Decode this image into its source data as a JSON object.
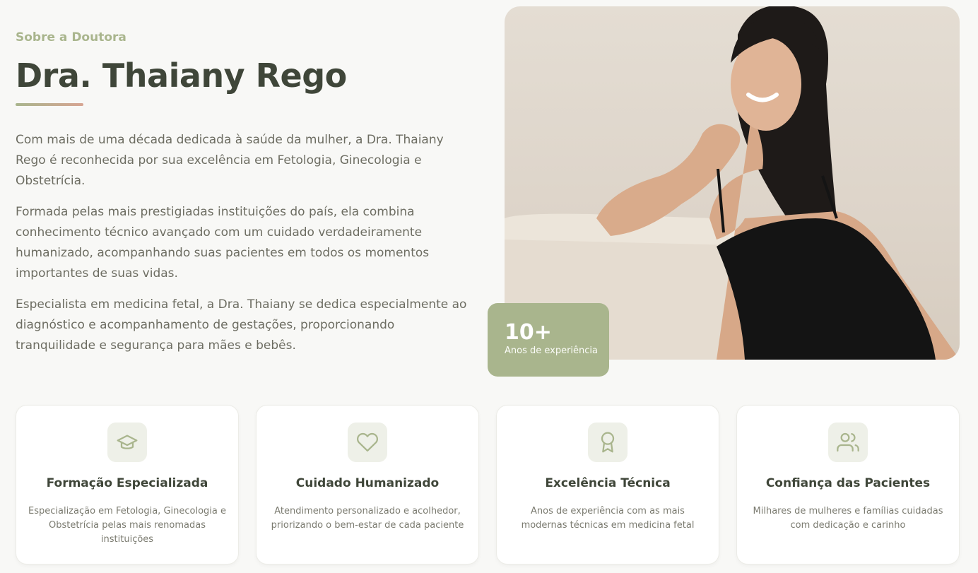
{
  "about": {
    "eyebrow": "Sobre a Doutora",
    "title": "Dra. Thaiany Rego",
    "paragraphs": [
      "Com mais de uma década dedicada à saúde da mulher, a Dra. Thaiany Rego é reconhecida por sua excelência em Fetologia, Ginecologia e Obstetrícia.",
      "Formada pelas mais prestigiadas instituições do país, ela combina conhecimento técnico avançado com um cuidado verdadeiramente humanizado, acompanhando suas pacientes em todos os momentos importantes de suas vidas.",
      "Especialista em medicina fetal, a Dra. Thaiany se dedica especialmente ao diagnóstico e acompanhamento de gestações, proporcionando tranquilidade e segurança para mães e bebês."
    ]
  },
  "experience": {
    "number": "10+",
    "label": "Anos de experiência"
  },
  "features": [
    {
      "icon": "graduation-cap-icon",
      "title": "Formação Especializada",
      "text": "Especialização em Fetologia, Ginecologia e Obstetrícia pelas mais renomadas instituições"
    },
    {
      "icon": "heart-icon",
      "title": "Cuidado Humanizado",
      "text": "Atendimento personalizado e acolhedor, priorizando o bem-estar de cada paciente"
    },
    {
      "icon": "award-icon",
      "title": "Excelência Técnica",
      "text": "Anos de experiência com as mais modernas técnicas em medicina fetal"
    },
    {
      "icon": "users-icon",
      "title": "Confiança das Pacientes",
      "text": "Milhares de mulheres e famílias cuidadas com dedicação e carinho"
    }
  ],
  "colors": {
    "accent": "#a9b58d",
    "heading": "#3f4639",
    "background": "#f8f8f6"
  }
}
